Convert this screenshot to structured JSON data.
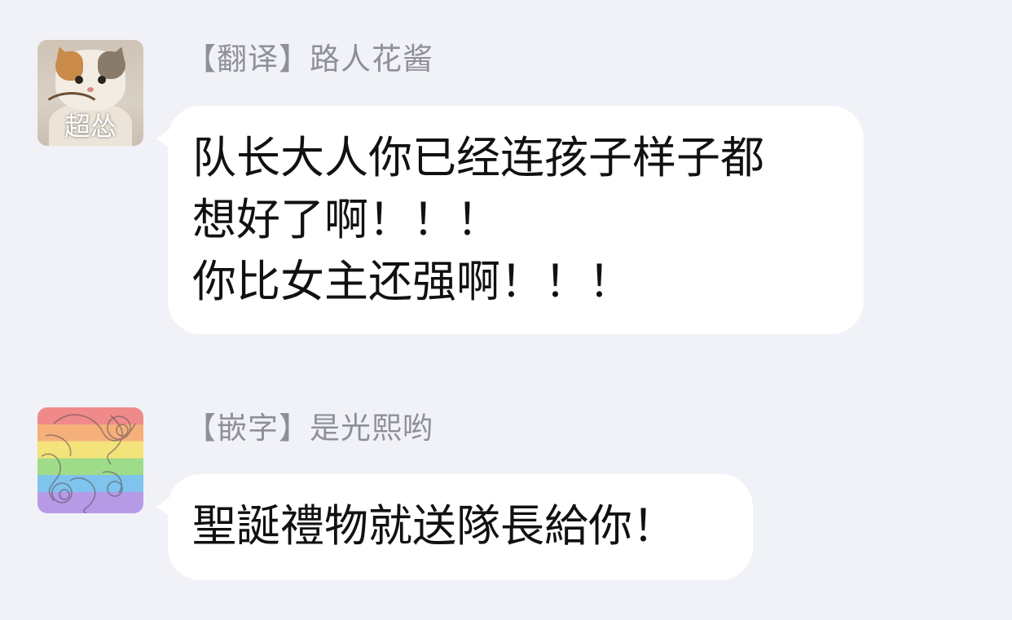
{
  "chat": {
    "messages": [
      {
        "sender": "【翻译】路人花酱",
        "avatar_icon": "cat-meme-avatar",
        "avatar_caption": "超怂",
        "lines": [
          "队长大人你已经连孩子样子都",
          "想好了啊！！！",
          "你比女主还强啊！！！"
        ]
      },
      {
        "sender": "【嵌字】是光熙哟",
        "avatar_icon": "rainbow-avatar",
        "lines": [
          "聖誕禮物就送隊長給你！"
        ]
      }
    ]
  },
  "colors": {
    "background": "#f1f2f7",
    "bubble": "#ffffff",
    "sender_text": "#8f9097",
    "message_text": "#111111"
  }
}
